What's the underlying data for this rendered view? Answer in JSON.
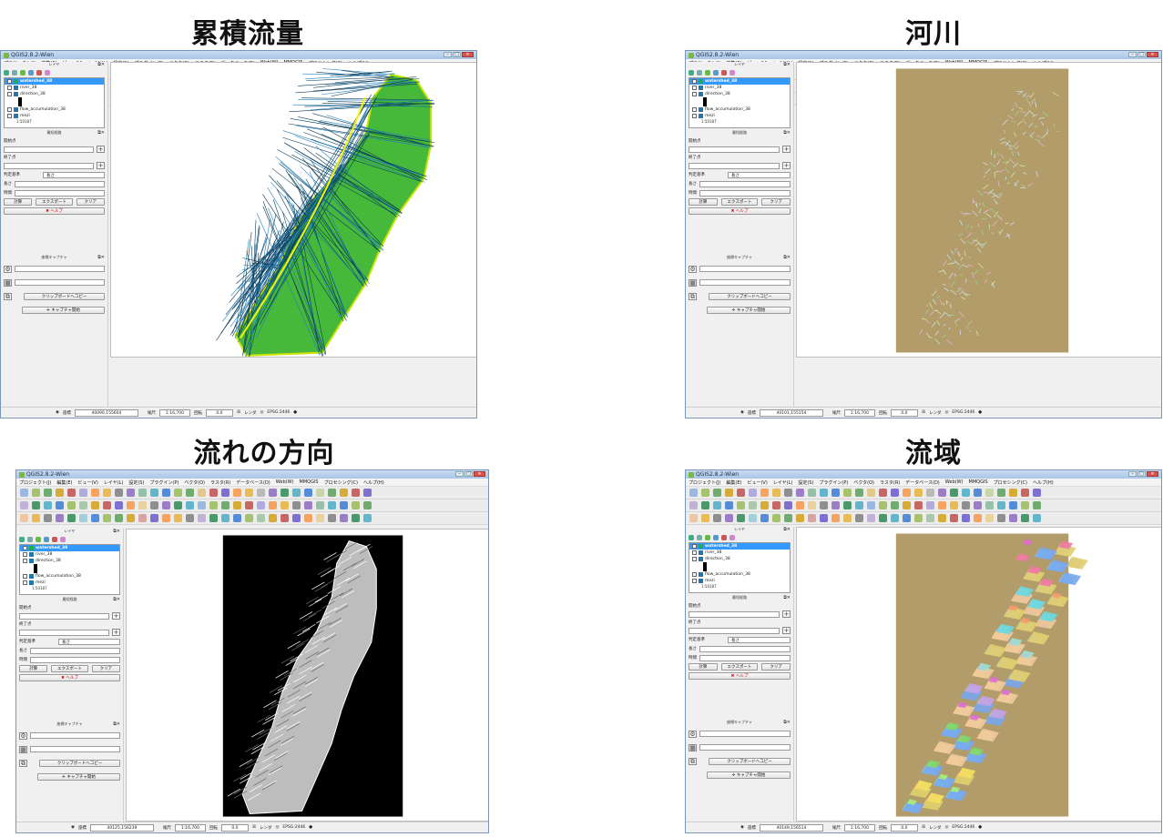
{
  "panels": [
    {
      "heading": "累積流量",
      "window_title": "QGIS2.8.2-Wien",
      "coord": "40090,155604",
      "scale": "1:16,700",
      "rotation": "0.0",
      "canvas_bg": "#ffffff",
      "map_style": "flow-accumulation"
    },
    {
      "heading": "河川",
      "window_title": "QGIS2.8.2-Wien",
      "coord": "40101,155154",
      "scale": "1:16,700",
      "rotation": "0.0",
      "canvas_bg": "#ffffff",
      "map_style": "river"
    },
    {
      "heading": "流れの方向",
      "window_title": "QGIS2.8.2-Wien",
      "coord": "40125,156239",
      "scale": "1:16,700",
      "rotation": "0.0",
      "canvas_bg": "#ffffff",
      "map_style": "flow-direction"
    },
    {
      "heading": "流域",
      "window_title": "QGIS2.8.2-Wien",
      "coord": "40149,156514",
      "scale": "1:16,700",
      "rotation": "0.0",
      "canvas_bg": "#ffffff",
      "map_style": "watershed"
    }
  ],
  "menu": [
    "プロジェクト(J)",
    "編集(E)",
    "ビュー(V)",
    "レイヤ(L)",
    "設定(S)",
    "プラグイン(P)",
    "ベクタ(O)",
    "ラスタ(R)",
    "データベース(D)",
    "Web(W)",
    "MMQGIS",
    "プロセシング(C)",
    "ヘルプ(H)"
  ],
  "layers_title": "レイヤ",
  "layers": {
    "watershed": "watershed_38",
    "river": "river_38",
    "direction": "direction_38",
    "flow": "flow_accumulation_38",
    "mesi": "mezi",
    "scale_note": "1:50187"
  },
  "route_panel": {
    "title": "最短経路",
    "start_label": "開始点",
    "end_label": "終了点",
    "criterion_label": "判定基準",
    "criterion_value": "長さ",
    "length_label": "長さ",
    "time_label": "時間",
    "calc_btn": "計算",
    "export_btn": "エクスポート",
    "clear_btn": "クリア",
    "help_btn": "ヘルプ"
  },
  "capture_panel": {
    "title": "座標キャプチャ",
    "copy_btn": "クリップボードへコピー",
    "start_btn": "キャプチャ開始"
  },
  "status": {
    "coord_label": "座標",
    "scale_label": "縮尺",
    "rotation_label": "回転",
    "render_label": "レンダ",
    "crs": "EPSG:2446"
  },
  "colors": {
    "accent": "#3399ff",
    "title_bar": "#b9d1ee",
    "close_button": "#d9534f"
  }
}
